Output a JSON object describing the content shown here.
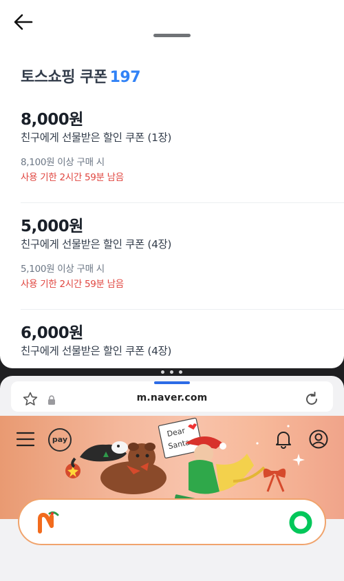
{
  "toss": {
    "title": "토스쇼핑 쿠폰",
    "count": "197",
    "coupons": [
      {
        "amount": "8,000원",
        "description": "친구에게 선물받은 할인 쿠폰 (1장)",
        "condition": "8,100원 이상 구매 시",
        "expiry": "사용 기한 2시간 59분 남음"
      },
      {
        "amount": "5,000원",
        "description": "친구에게 선물받은 할인 쿠폰 (4장)",
        "condition": "5,100원 이상 구매 시",
        "expiry": "사용 기한 2시간 59분 남음"
      },
      {
        "amount": "6,000원",
        "description": "친구에게 선물받은 할인 쿠폰 (4장)",
        "condition": "",
        "expiry": ""
      }
    ]
  },
  "browser": {
    "url": "m.naver.com",
    "pay_label": "pay",
    "banner_card_text_1": "Dear",
    "banner_card_text_2": "Santa",
    "icons": {
      "back": "arrow-left-icon",
      "favorite": "star-icon",
      "secure": "lock-icon",
      "reload": "reload-icon",
      "menu": "hamburger-menu-icon",
      "notifications": "bell-icon",
      "profile": "profile-icon",
      "logo": "naver-logo",
      "lens": "green-lens-icon"
    }
  },
  "colors": {
    "accent_blue": "#3182f6",
    "expiry_red": "#e0453f",
    "naver_green": "#03c75a",
    "search_border": "#f0a36c"
  }
}
